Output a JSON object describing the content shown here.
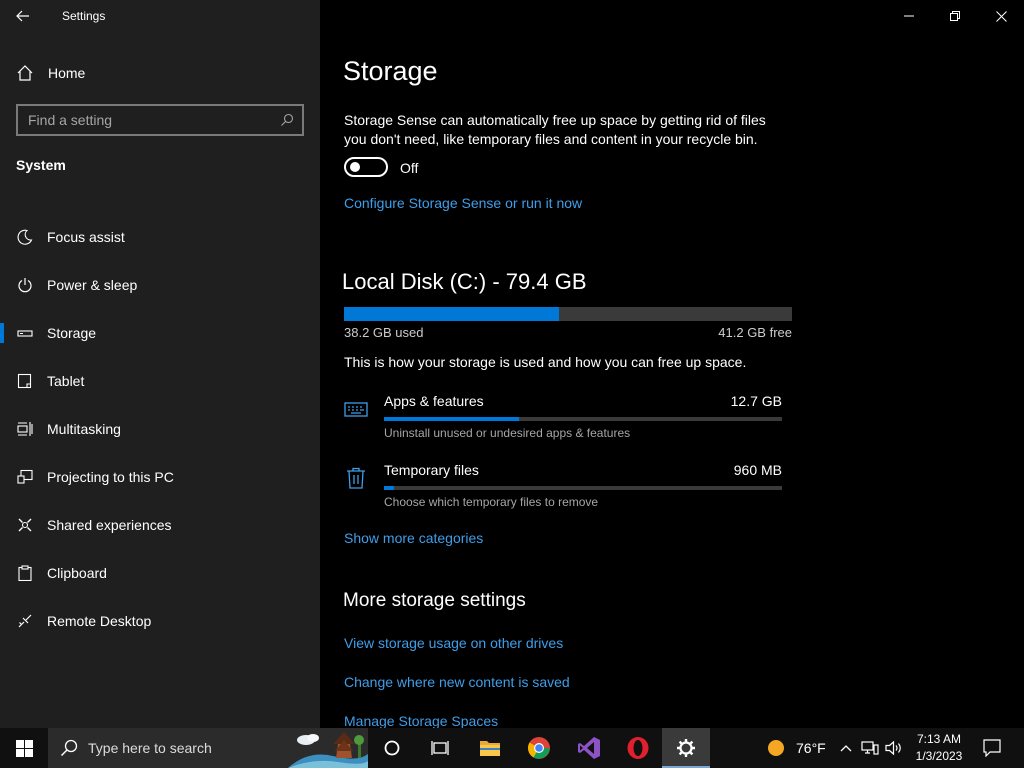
{
  "sidebar": {
    "app_title": "Settings",
    "home_label": "Home",
    "search_placeholder": "Find a setting",
    "section_title": "System",
    "items": [
      {
        "label": "Focus assist",
        "icon": "moon-icon"
      },
      {
        "label": "Power & sleep",
        "icon": "power-icon"
      },
      {
        "label": "Storage",
        "icon": "storage-icon",
        "selected": true
      },
      {
        "label": "Tablet",
        "icon": "tablet-icon"
      },
      {
        "label": "Multitasking",
        "icon": "multitasking-icon"
      },
      {
        "label": "Projecting to this PC",
        "icon": "projecting-icon"
      },
      {
        "label": "Shared experiences",
        "icon": "shared-experiences-icon"
      },
      {
        "label": "Clipboard",
        "icon": "clipboard-icon"
      },
      {
        "label": "Remote Desktop",
        "icon": "remote-desktop-icon"
      }
    ]
  },
  "main": {
    "title": "Storage",
    "storage_sense": {
      "description": "Storage Sense can automatically free up space by getting rid of files you don't need, like temporary files and content in your recycle bin.",
      "toggle_state": "Off",
      "configure_link": "Configure Storage Sense or run it now"
    },
    "disk": {
      "title": "Local Disk (C:) - 79.4 GB",
      "used_label": "38.2 GB used",
      "free_label": "41.2 GB free",
      "used_fraction": 0.48,
      "description": "This is how your storage is used and how you can free up space."
    },
    "categories": [
      {
        "name": "Apps & features",
        "size": "12.7 GB",
        "sub": "Uninstall unused or undesired apps & features",
        "fraction": 0.34,
        "icon": "keyboard-icon"
      },
      {
        "name": "Temporary files",
        "size": "960 MB",
        "sub": "Choose which temporary files to remove",
        "fraction": 0.025,
        "icon": "trash-icon"
      }
    ],
    "show_more_link": "Show more categories",
    "more_title": "More storage settings",
    "more_links": [
      "View storage usage on other drives",
      "Change where new content is saved",
      "Manage Storage Spaces"
    ]
  },
  "taskbar": {
    "search_placeholder": "Type here to search",
    "weather_temp": "76°F",
    "time": "7:13 AM",
    "date": "1/3/2023"
  },
  "colors": {
    "accent": "#0078d7",
    "link": "#3f9ee9",
    "sidebar_bg": "#1f1f1f",
    "main_bg": "#000000"
  }
}
